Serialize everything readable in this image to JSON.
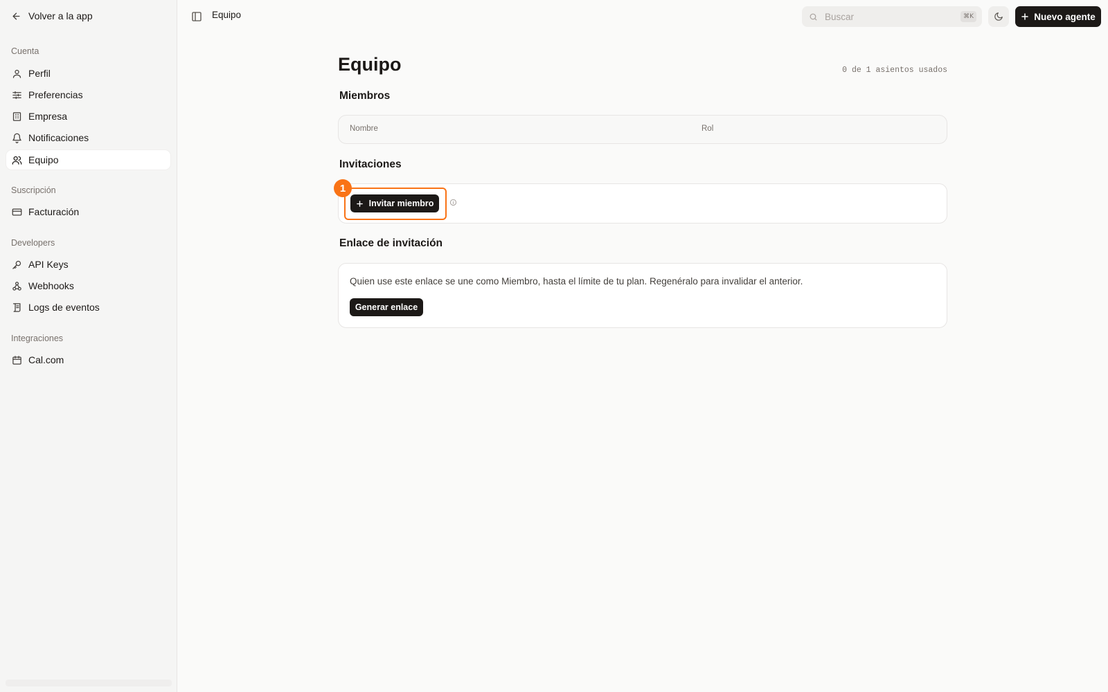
{
  "sidebar": {
    "back_label": "Volver a la app",
    "sections": [
      {
        "label": "Cuenta"
      },
      {
        "label": "Suscripción"
      },
      {
        "label": "Developers"
      },
      {
        "label": "Integraciones"
      }
    ],
    "items": [
      {
        "label": "Perfil",
        "icon": "user-icon"
      },
      {
        "label": "Preferencias",
        "icon": "sliders-icon"
      },
      {
        "label": "Empresa",
        "icon": "building-icon"
      },
      {
        "label": "Notificaciones",
        "icon": "bell-icon"
      },
      {
        "label": "Equipo",
        "icon": "users-icon",
        "active": true
      },
      {
        "label": "Facturación",
        "icon": "credit-card-icon"
      },
      {
        "label": "API Keys",
        "icon": "key-icon"
      },
      {
        "label": "Webhooks",
        "icon": "webhook-icon"
      },
      {
        "label": "Logs de eventos",
        "icon": "scroll-icon"
      },
      {
        "label": "Cal.com",
        "icon": "calendar-icon"
      }
    ]
  },
  "topbar": {
    "breadcrumb": "Equipo",
    "search_placeholder": "Buscar",
    "search_shortcut": "⌘K",
    "new_agent_label": "Nuevo agente"
  },
  "page": {
    "title": "Equipo",
    "seats": "0 de 1 asientos usados",
    "members": {
      "title": "Miembros",
      "columns": [
        "Nombre",
        "Rol"
      ]
    },
    "invitations": {
      "title": "Invitaciones",
      "invite_label": "Invitar miembro",
      "annotation_number": "1"
    },
    "invite_link": {
      "title": "Enlace de invitación",
      "description": "Quien use este enlace se une como Miembro, hasta el límite de tu plan. Regenéralo para invalidar el anterior.",
      "generate_label": "Generar enlace"
    }
  },
  "colors": {
    "accent": "#f97316",
    "primary_button": "#1c1917",
    "background": "#fafaf9",
    "sidebar_bg": "#f5f5f4"
  }
}
